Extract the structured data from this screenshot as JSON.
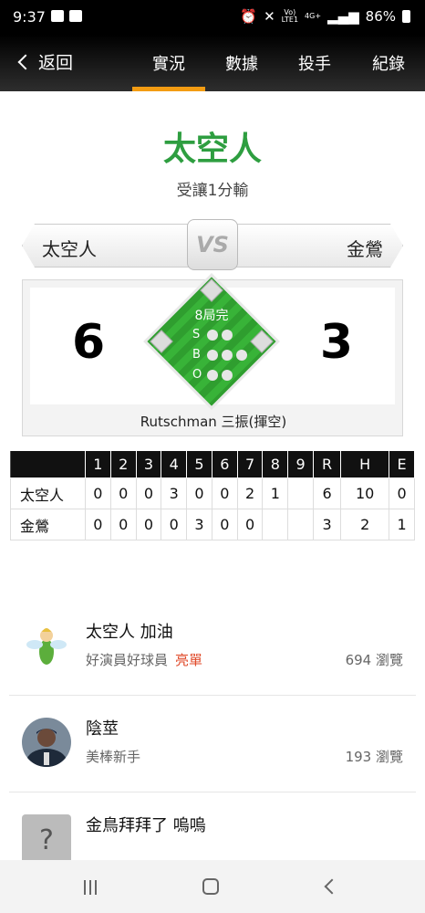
{
  "status_bar": {
    "time": "9:37",
    "network_top": "Vo)",
    "network_bottom": "LTE1",
    "network_type": "4G+",
    "battery": "86%"
  },
  "nav": {
    "back_label": "返回",
    "tabs": [
      "實況",
      "數據",
      "投手",
      "紀錄"
    ],
    "active_tab": 0,
    "accent_color": "#f39c12"
  },
  "game": {
    "headline_team": "太空人",
    "result_text": "受讓1分輸",
    "away_team": "太空人",
    "home_team": "金鶯",
    "vs_label": "VS",
    "away_score": "6",
    "home_score": "3",
    "inning_status": "8局完",
    "count_labels": [
      "S",
      "B",
      "O"
    ],
    "last_play": "Rutschman 三振(揮空)",
    "accent_color": "#2e9e40"
  },
  "linescore": {
    "headers": [
      "",
      "1",
      "2",
      "3",
      "4",
      "5",
      "6",
      "7",
      "8",
      "9",
      "R",
      "H",
      "E"
    ],
    "rows": [
      [
        "太空人",
        "0",
        "0",
        "0",
        "3",
        "0",
        "0",
        "2",
        "1",
        "",
        "6",
        "10",
        "0"
      ],
      [
        "金鶯",
        "0",
        "0",
        "0",
        "0",
        "3",
        "0",
        "0",
        "",
        "",
        "3",
        "2",
        "1"
      ]
    ]
  },
  "feed": [
    {
      "title": "太空人 加油",
      "author": "好演員好球員",
      "tag": "亮單",
      "views": "694 瀏覽",
      "avatar": "fairy-avatar"
    },
    {
      "title": "陰莖",
      "author": "美棒新手",
      "tag": "",
      "views": "193 瀏覽",
      "avatar": "player-avatar"
    },
    {
      "title": "金鳥拜拜了 嗚嗚",
      "author": "",
      "tag": "",
      "views": "",
      "avatar": "unknown-avatar"
    }
  ]
}
